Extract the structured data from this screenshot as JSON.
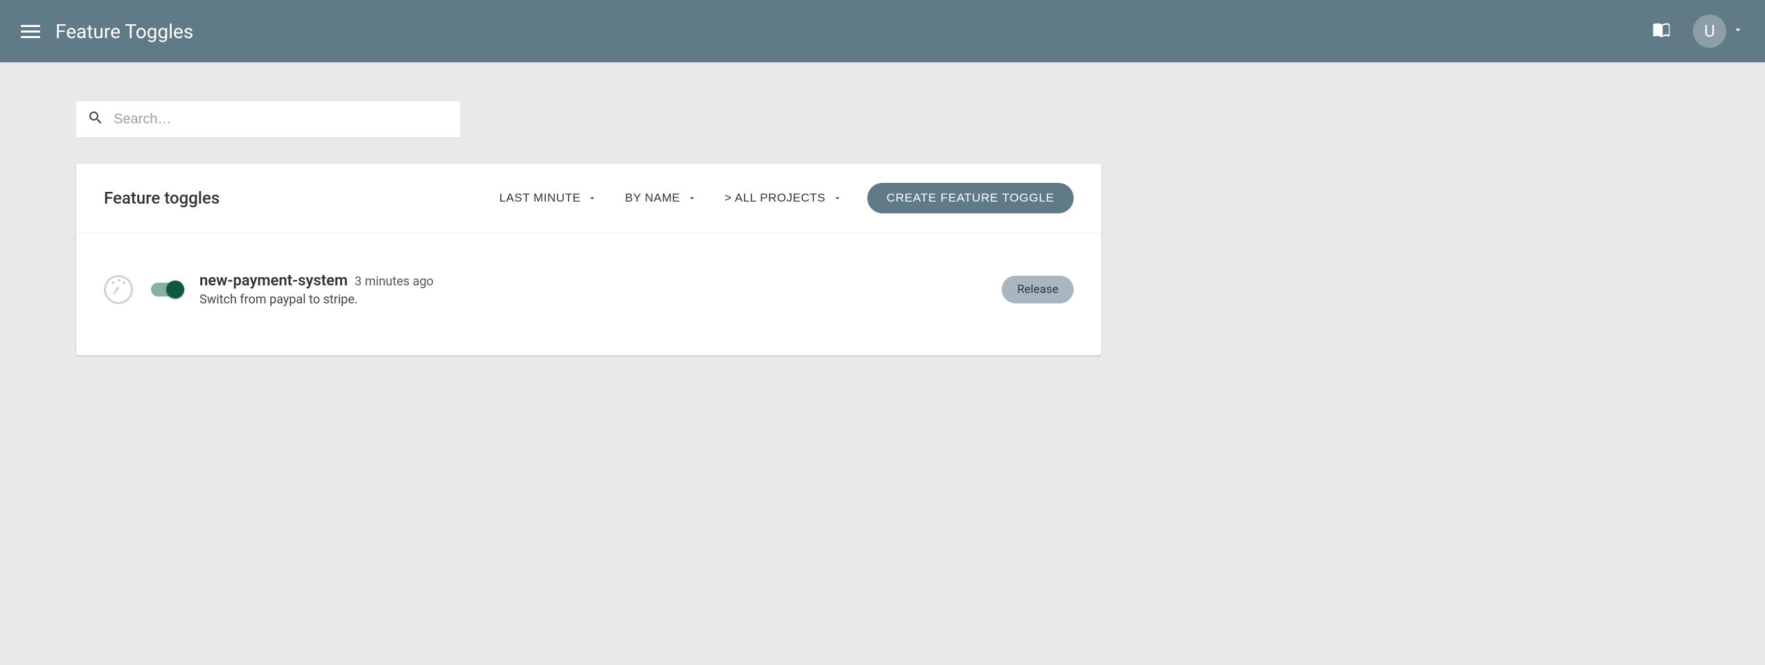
{
  "header": {
    "title": "Feature Toggles",
    "avatar_initial": "U"
  },
  "search": {
    "placeholder": "Search…",
    "value": ""
  },
  "card": {
    "title": "Feature toggles",
    "filters": {
      "time": "LAST MINUTE",
      "sort": "BY NAME",
      "project": "> ALL PROJECTS"
    },
    "create_label": "CREATE FEATURE TOGGLE"
  },
  "toggles": [
    {
      "name": "new-payment-system",
      "timestamp": "3 minutes ago",
      "description": "Switch from paypal to stripe.",
      "enabled": true,
      "badge": "Release"
    }
  ]
}
